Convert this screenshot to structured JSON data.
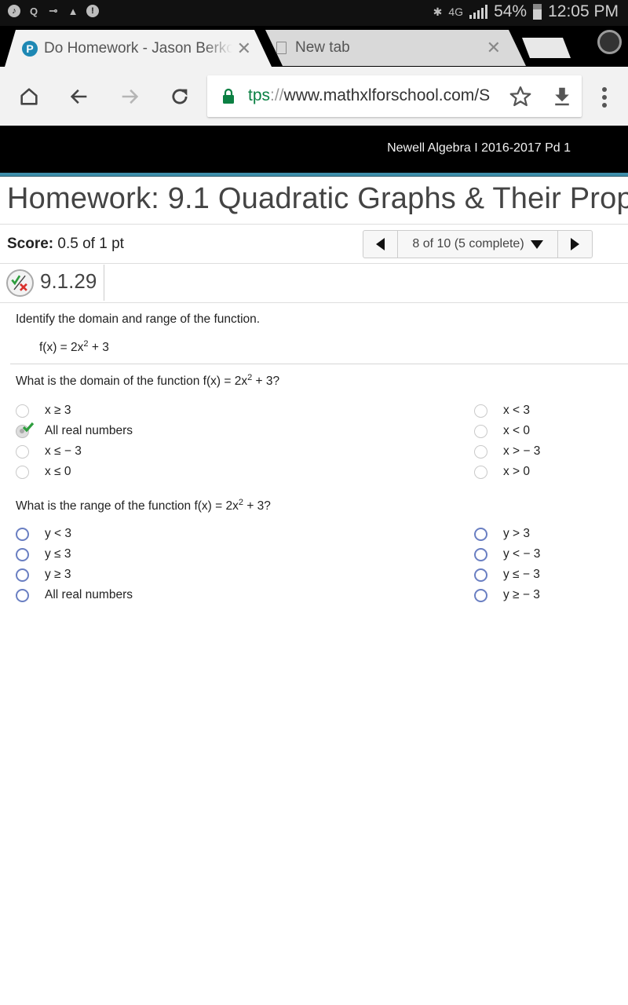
{
  "status_bar": {
    "left_icons": [
      "music-icon",
      "q-icon",
      "key-icon",
      "warning-icon",
      "alert-icon"
    ],
    "network": "4G",
    "battery": "54%",
    "time": "12:05 PM"
  },
  "browser": {
    "tabs": [
      {
        "title": "Do Homework - Jason Berkov",
        "favicon": "P",
        "active": true
      },
      {
        "title": "New tab",
        "active": false
      }
    ],
    "url": {
      "scheme_part": "tps",
      "separator": "://",
      "host": "www.mathxlforschool.com/S"
    }
  },
  "site": {
    "course": "Newell Algebra I 2016-2017 Pd 1",
    "homework_title": "Homework: 9.1 Quadratic Graphs & Their Prop",
    "score_label": "Score:",
    "score_value": "0.5 of 1 pt",
    "pager_text": "8 of 10 (5 complete)",
    "question_id": "9.1.29"
  },
  "problem": {
    "instruction": "Identify the domain and range of the function.",
    "function_base": "f(x) = 2x",
    "function_exp": "2",
    "function_tail": " + 3",
    "domain_question": {
      "prefix": "What is the domain of the function f(x) = 2x",
      "exp": "2",
      "suffix": " + 3?",
      "options_left": [
        "x ≥ 3",
        "All real numbers",
        "x ≤  − 3",
        "x ≤ 0"
      ],
      "options_right": [
        "x < 3",
        "x < 0",
        "x >  − 3",
        "x > 0"
      ],
      "selected": "All real numbers",
      "selected_correct": true
    },
    "range_question": {
      "prefix": "What is the range of the function f(x) = 2x",
      "exp": "2",
      "suffix": " + 3?",
      "options_left": [
        "y < 3",
        "y ≤ 3",
        "y ≥ 3",
        "All real numbers"
      ],
      "options_right": [
        "y > 3",
        "y <  − 3",
        "y ≤  − 3",
        "y ≥  − 3"
      ],
      "selected": null
    }
  },
  "colors": {
    "accent_bar": "#3e8eaa",
    "lock_green": "#0b8043",
    "check_green": "#2e9e3e",
    "wrong_red": "#d9302c",
    "radio_blue": "#6a7fc2"
  }
}
